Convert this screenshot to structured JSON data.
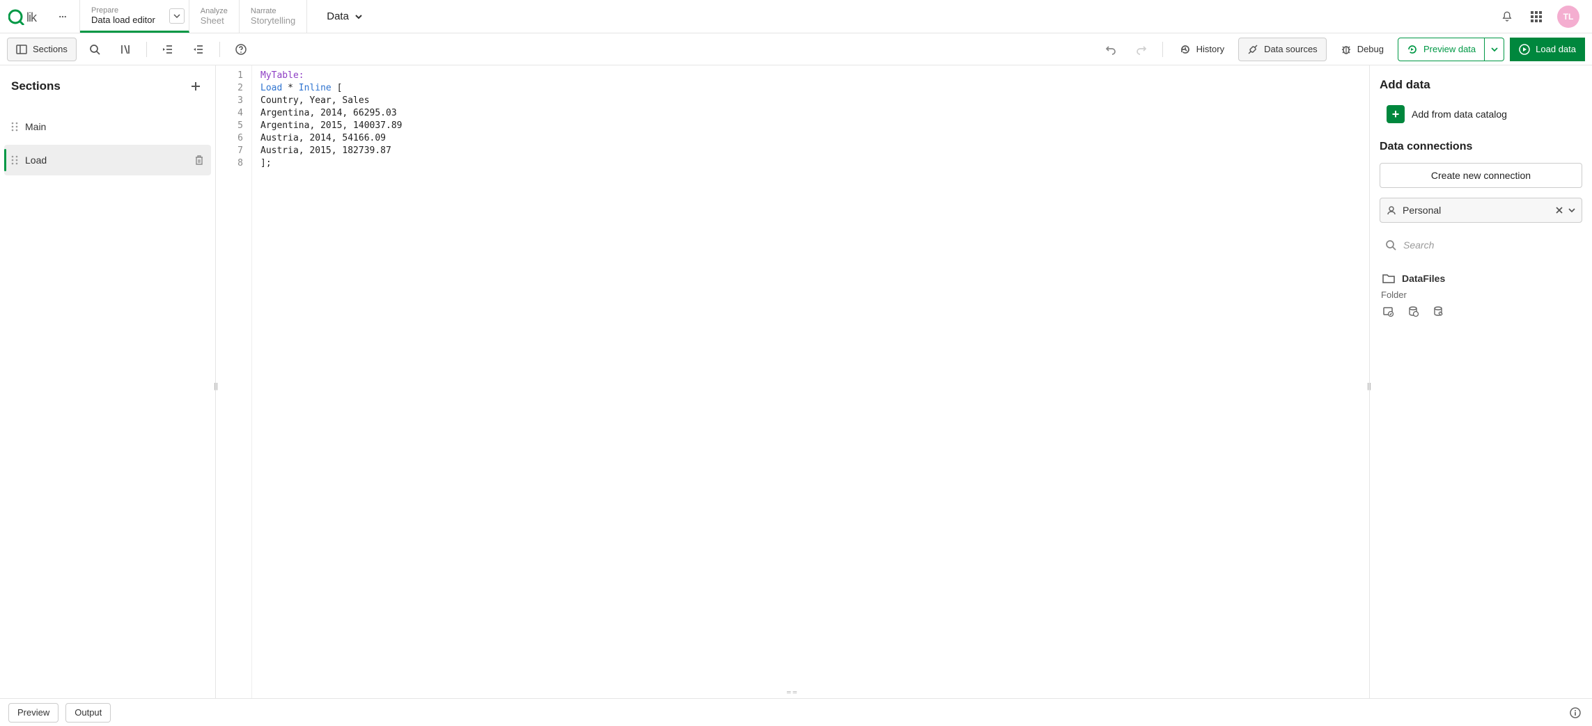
{
  "topnav": {
    "brand": "Qlik",
    "tabs": [
      {
        "sup": "Prepare",
        "label": "Data load editor",
        "active": true,
        "hasChevron": true
      },
      {
        "sup": "Analyze",
        "label": "Sheet",
        "active": false,
        "hasChevron": false
      },
      {
        "sup": "Narrate",
        "label": "Storytelling",
        "active": false,
        "hasChevron": false
      }
    ],
    "data_dropdown": "Data",
    "avatar": "TL"
  },
  "toolbar": {
    "sections_btn": "Sections",
    "history": "History",
    "data_sources": "Data sources",
    "debug": "Debug",
    "preview_data": "Preview data",
    "load_data": "Load data"
  },
  "sections_pane": {
    "title": "Sections",
    "items": [
      {
        "label": "Main",
        "selected": false
      },
      {
        "label": "Load",
        "selected": true
      }
    ]
  },
  "editor": {
    "lines": [
      {
        "n": 1,
        "text": "MyTable:",
        "tokens": [
          [
            "MyTable:",
            "table"
          ]
        ]
      },
      {
        "n": 2,
        "text": "Load * Inline [",
        "tokens": [
          [
            "Load",
            "kw"
          ],
          [
            " ",
            ""
          ],
          [
            "*",
            ""
          ],
          [
            " ",
            ""
          ],
          [
            "Inline",
            "kw"
          ],
          [
            " ",
            ""
          ],
          [
            "[",
            ""
          ]
        ]
      },
      {
        "n": 3,
        "text": "Country, Year, Sales"
      },
      {
        "n": 4,
        "text": "Argentina, 2014, 66295.03"
      },
      {
        "n": 5,
        "text": "Argentina, 2015, 140037.89"
      },
      {
        "n": 6,
        "text": "Austria, 2014, 54166.09"
      },
      {
        "n": 7,
        "text": "Austria, 2015, 182739.87"
      },
      {
        "n": 8,
        "text": "];"
      }
    ]
  },
  "right_pane": {
    "add_data_title": "Add data",
    "add_catalog_btn": "Add from data catalog",
    "data_connections_title": "Data connections",
    "create_conn_btn": "Create new connection",
    "space_select": "Personal",
    "search_placeholder": "Search",
    "connections": [
      {
        "name": "DataFiles",
        "subtype": "Folder"
      }
    ]
  },
  "footer": {
    "preview": "Preview",
    "output": "Output"
  }
}
